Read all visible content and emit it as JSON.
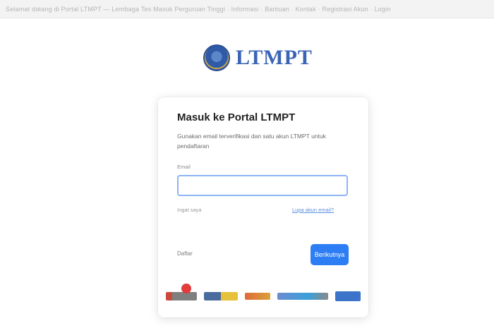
{
  "topbar": {
    "text": "Selamat datang di Portal LTMPT — Lembaga Tes Masuk Perguruan Tinggi · Informasi · Bantuan · Kontak · Registrasi Akun · Login"
  },
  "logo": {
    "text": "LTMPT",
    "seal_icon": "ltmpt-seal-icon"
  },
  "card": {
    "title": "Masuk ke Portal LTMPT",
    "subtitle": "Gunakan email terverifikasi dan satu akun LTMPT untuk pendaftaran",
    "email_label": "Email",
    "email_value": "",
    "email_placeholder": "",
    "remember_label": "Ingat saya",
    "forgot_link": "Lupa akun email?",
    "back_label": "Daftar",
    "next_label": "Berikutnya"
  },
  "partners": {
    "items": [
      "partner-logo-1",
      "partner-logo-2",
      "partner-logo-3",
      "partner-logo-4",
      "partner-logo-5"
    ]
  },
  "colors": {
    "accent": "#2d7df4",
    "brand": "#3b64b6",
    "link": "#5c8fdc"
  }
}
